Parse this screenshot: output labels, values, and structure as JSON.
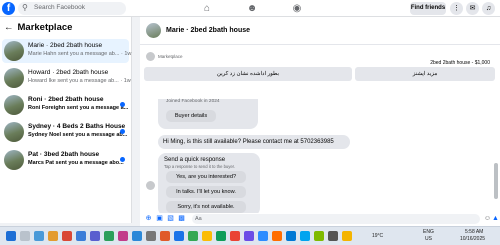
{
  "topbar": {
    "logo_letter": "f",
    "search_placeholder": "Search Facebook",
    "find_friends_label": "Find friends",
    "nav_icons": [
      "home-icon",
      "friends-icon",
      "groups-icon"
    ],
    "right_icons": [
      "menu-grid-icon",
      "messenger-icon",
      "notifications-icon",
      "profile-avatar"
    ]
  },
  "sidebar": {
    "title": "Marketplace",
    "conversations": [
      {
        "title": "Marie · 2bed 2bath house",
        "preview": "Marie Hahn sent you a message ab...",
        "time": "1w",
        "unread": false
      },
      {
        "title": "Howard · 2bed 2bath house",
        "preview": "Howard Ike sent you a message ab...",
        "time": "1w",
        "unread": false
      },
      {
        "title": "Roni · 2bed 2bath house",
        "preview": "Roni Foreighn sent you a message a...",
        "time": "",
        "unread": true
      },
      {
        "title": "Sydney · 4 Beds 2 Baths House",
        "preview": "Sydney Noel sent you a message ab...",
        "time": "",
        "unread": true
      },
      {
        "title": "Pat · 3bed 2bath house",
        "preview": "Marcs Pat sent you a message abo...",
        "time": "",
        "unread": true
      }
    ]
  },
  "chat": {
    "header_title": "Marie · 2bed 2bath house",
    "marketplace_label": "Marketplace",
    "listing_price": "2bed 2bath house - $1,000",
    "action_left": "بطور اداشده نشان زد کرین",
    "action_right": "مزید اپشنز",
    "joined_text": "Joined Facebook in 2024",
    "buyer_details_label": "Buyer details",
    "message_text": "Hi Ming, is this still available? Please contact me at 5702363985",
    "quick_response_title": "Send a quick response",
    "quick_response_subtitle": "Tap a response to send it to the buyer.",
    "quick_responses": [
      "Yes, are you interested?",
      "In talks. I'll let you know.",
      "Sorry, it's not available."
    ],
    "composer_placeholder": "Aa"
  },
  "taskbar": {
    "weather": "19°C",
    "lang": "ENG",
    "region": "US",
    "time": "5:58 AM",
    "date": "10/16/2025"
  },
  "colors": {
    "accent": "#0866ff",
    "unread_dot": "#0866ff",
    "active_row": "#e7f3ff"
  }
}
